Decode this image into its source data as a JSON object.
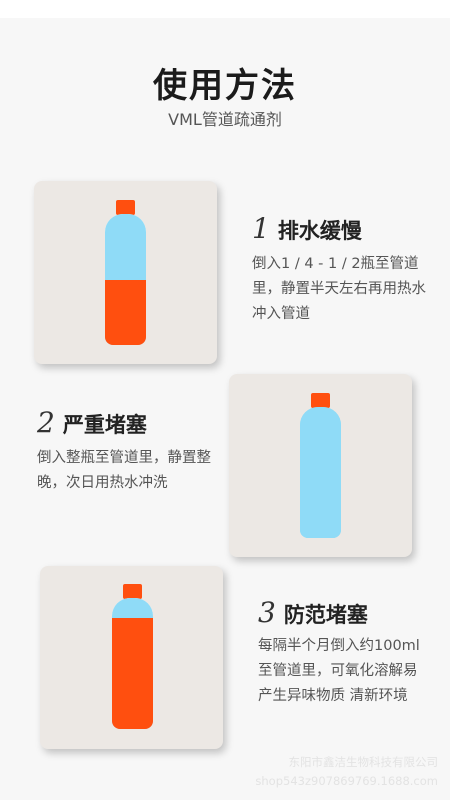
{
  "header": {
    "title": "使用方法",
    "subtitle": "VML管道疏通剂"
  },
  "steps": [
    {
      "number": "1",
      "title": "排水缓慢",
      "description": "倒入1 / 4 - 1 / 2瓶至管道里，静置半天左右再用热水冲入管道",
      "bottle_fill_fraction": 0.5
    },
    {
      "number": "2",
      "title": "严重堵塞",
      "description": "倒入整瓶至管道里，静置整晚，次日用热水冲洗",
      "bottle_fill_fraction": 1.0
    },
    {
      "number": "3",
      "title": "防范堵塞",
      "description": "每隔半个月倒入约100ml至管道里，可氧化溶解易产生异味物质 清新环境",
      "bottle_fill_fraction": 0.85
    }
  ],
  "watermark": {
    "company": "东阳市鑫洁生物科技有限公司",
    "shop": "shop543z907869769.1688.com"
  },
  "colors": {
    "cap_orange": "#ff4f0f",
    "liquid_blue": "#8fdbf7",
    "card_bg": "#ece8e4"
  }
}
